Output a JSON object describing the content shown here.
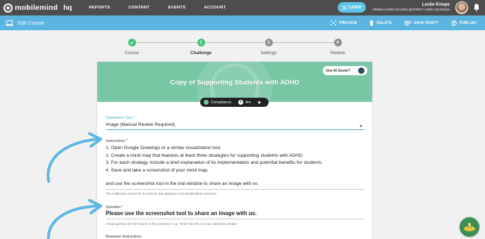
{
  "topbar": {
    "logo_text": "mobilemind",
    "logo_hq": "hq",
    "nav": [
      "REPORTS",
      "CONTENT",
      "EVENTS",
      "ACCOUNT"
    ],
    "learn_label": "Learn",
    "user_name": "Leslie Knope",
    "user_org": "GREEN ACRES SCHOOL DISTRICT • VIEW HQ ROLES"
  },
  "editbar": {
    "title": "Edit Course",
    "actions": {
      "preview": "PREVIEW",
      "delete": "DELETE",
      "save_draft": "SAVE DRAFT",
      "publish": "PUBLISH"
    }
  },
  "steps": [
    {
      "number": "✓",
      "label": "Course",
      "state": "complete"
    },
    {
      "number": "2",
      "label": "Challenge",
      "state": "active"
    },
    {
      "number": "3",
      "label": "Settings",
      "state": "upcoming"
    },
    {
      "number": "4",
      "label": "Review",
      "state": "upcoming"
    }
  ],
  "card": {
    "title": "Copy of Supporting Students with ADHD",
    "genie_label": "Use AI Genie?",
    "pill": {
      "category": "Compliance",
      "duration": "4m"
    },
    "submission_type": {
      "label": "Submission Type *",
      "value": "Image (Manual Review Required)"
    },
    "instructions": {
      "label": "Instructions *",
      "lines": [
        "1. Open Google Drawings or a similar visualization tool.",
        "2. Create a mind map that features at least three strategies for supporting students with ADHD.",
        "3. For each strategy, include a brief explanation of its implementation and potential benefits for students.",
        "4. Save and take a screenshot of your mind map."
      ],
      "tail": "and use the screenshot tool in the trial window to share an image with us.",
      "help": "The challenge content for the learner that appears in the MobileMind extension."
    },
    "question": {
      "label": "Question *",
      "value": "Please use the screenshot tool to share an image with us.",
      "help": "A final question for the learner in the extension, e.g. \"Enter the URL to your submission below.\""
    },
    "reviewer_label": "Reviewer Instructions"
  },
  "colors": {
    "topbar": "#4d4d4d",
    "editbar": "#5bb5e0",
    "banner": "#78c7a4",
    "step_complete": "#3ec27a",
    "step_active": "#3ec27a",
    "step_upcoming": "#8f8f8f",
    "arrow": "#5bb8e2"
  }
}
